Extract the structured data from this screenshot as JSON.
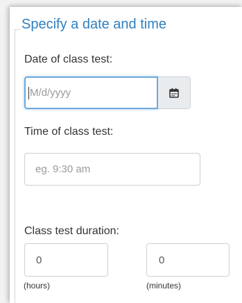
{
  "section": {
    "legend": "Specify a date and time"
  },
  "date": {
    "label": "Date of class test:",
    "placeholder": "M/d/yyyy",
    "calendar_icon": "calendar-icon"
  },
  "time": {
    "label": "Time of class test:",
    "placeholder": "eg. 9:30 am"
  },
  "duration": {
    "label": "Class test duration:",
    "hours_value": "0",
    "minutes_value": "0",
    "hours_caption": "(hours)",
    "minutes_caption": "(minutes)"
  },
  "colors": {
    "accent": "#2f7fbf",
    "focus_border": "#6fa8dc",
    "addon_bg": "#e9ecef"
  }
}
